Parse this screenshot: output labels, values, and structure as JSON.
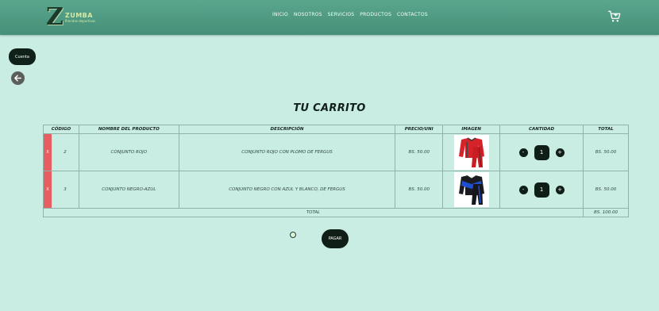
{
  "brand": {
    "logo_letter": "Z",
    "name": "ZUMBA",
    "tagline": "Prendas deportivas"
  },
  "nav": {
    "items": [
      "INICIO",
      "NOSOTROS",
      "SERVICIOS",
      "PRODUCTOS",
      "CONTACTOS"
    ]
  },
  "account": {
    "label": "Cuenta"
  },
  "cart": {
    "title": "TU CARRITO",
    "headers": [
      "CÓDIGO",
      "NOMBRE DEL PRODUCTO",
      "DESCRIPCIÓN",
      "PRECIO/UNI",
      "IMAGEN",
      "CANTIDAD",
      "TOTAL"
    ],
    "rows": [
      {
        "delete": "X",
        "code": "2",
        "name": "CONJUNTO ROJO",
        "description": "CONJUNTO ROJO CON PLOMO DE FERGUS",
        "price": "BS. 50.00",
        "image_icon": "red-tracksuit-image",
        "qty_minus": "-",
        "qty": "1",
        "qty_plus": "+",
        "total": "BS. 50.00"
      },
      {
        "delete": "X",
        "code": "3",
        "name": "CONJUNTO NEGRO-AZUL",
        "description": "CONJUNTO NEGRO CON AZUL Y BLANCO, DE FERGUS",
        "price": "BS. 50.00",
        "image_icon": "blue-black-tracksuit-image",
        "qty_minus": "-",
        "qty": "1",
        "qty_plus": "+",
        "total": "BS. 50.00"
      }
    ],
    "total_label": "TOTAL",
    "total_value": "BS. 100.00"
  },
  "pay": {
    "label": "PAGAR"
  },
  "colors": {
    "header": "#4e9c84",
    "background": "#c9ece3",
    "delete": "#e85d60",
    "dark": "#0f1f17"
  }
}
